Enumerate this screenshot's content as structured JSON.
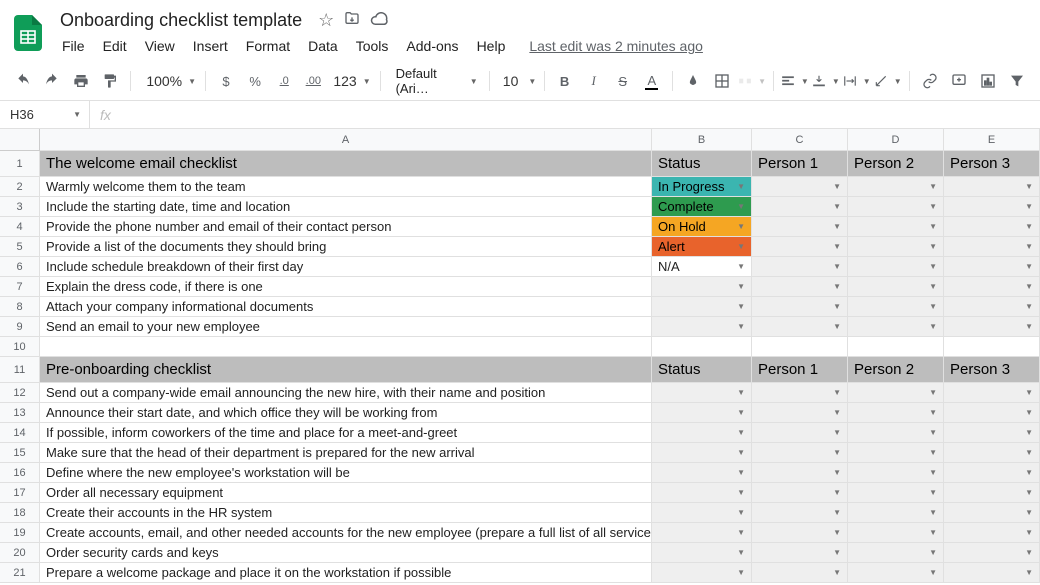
{
  "doc": {
    "title": "Onboarding checklist template"
  },
  "menu": {
    "items": [
      "File",
      "Edit",
      "View",
      "Insert",
      "Format",
      "Data",
      "Tools",
      "Add-ons",
      "Help"
    ],
    "last_edit": "Last edit was 2 minutes ago"
  },
  "toolbar": {
    "zoom": "100%",
    "font": "Default (Ari…",
    "font_size": "10",
    "currency": "$",
    "percent": "%",
    "dec_dec": ".0",
    "dec_inc": ".00",
    "more_fmt": "123",
    "bold": "B",
    "italic": "I",
    "strike": "S",
    "textcolor": "A"
  },
  "name_box": "H36",
  "formula": "",
  "fx_label": "fx",
  "columns": [
    "A",
    "B",
    "C",
    "D",
    "E"
  ],
  "sheet": {
    "section1": {
      "title": "The welcome email checklist",
      "status_label": "Status",
      "persons": [
        "Person 1",
        "Person 2",
        "Person 3"
      ],
      "rows": [
        {
          "text": "Warmly welcome them to the team",
          "status": "In Progress",
          "status_class": "status-inprogress"
        },
        {
          "text": "Include the starting date, time and location",
          "status": "Complete",
          "status_class": "status-complete"
        },
        {
          "text": "Provide the phone number and email of their contact person",
          "status": "On Hold",
          "status_class": "status-onhold"
        },
        {
          "text": "Provide a list of the documents they should bring",
          "status": "Alert",
          "status_class": "status-alert"
        },
        {
          "text": "Include schedule breakdown of their first day",
          "status": "N/A",
          "status_class": "white"
        },
        {
          "text": "Explain the dress code, if there is one",
          "status": "",
          "status_class": ""
        },
        {
          "text": "Attach your company informational documents",
          "status": "",
          "status_class": ""
        },
        {
          "text": "Send an email to your new employee",
          "status": "",
          "status_class": ""
        }
      ]
    },
    "section2": {
      "title": "Pre-onboarding checklist",
      "status_label": "Status",
      "persons": [
        "Person 1",
        "Person 2",
        "Person 3"
      ],
      "rows": [
        {
          "text": "Send out a company-wide email announcing the new hire, with their name and position"
        },
        {
          "text": "Announce their start date, and which office they will be working from"
        },
        {
          "text": "If possible, inform coworkers of the time and place for a meet-and-greet"
        },
        {
          "text": "Make sure that the head of their department is prepared for the new arrival"
        },
        {
          "text": "Define where the new employee's workstation will be"
        },
        {
          "text": "Order all necessary equipment"
        },
        {
          "text": "Create their accounts in the HR system"
        },
        {
          "text": "Create accounts, email, and other needed accounts for the new employee (prepare a full list of all services)"
        },
        {
          "text": "Order security cards and keys"
        },
        {
          "text": "Prepare a welcome package and place it on the workstation if possible"
        }
      ]
    }
  }
}
